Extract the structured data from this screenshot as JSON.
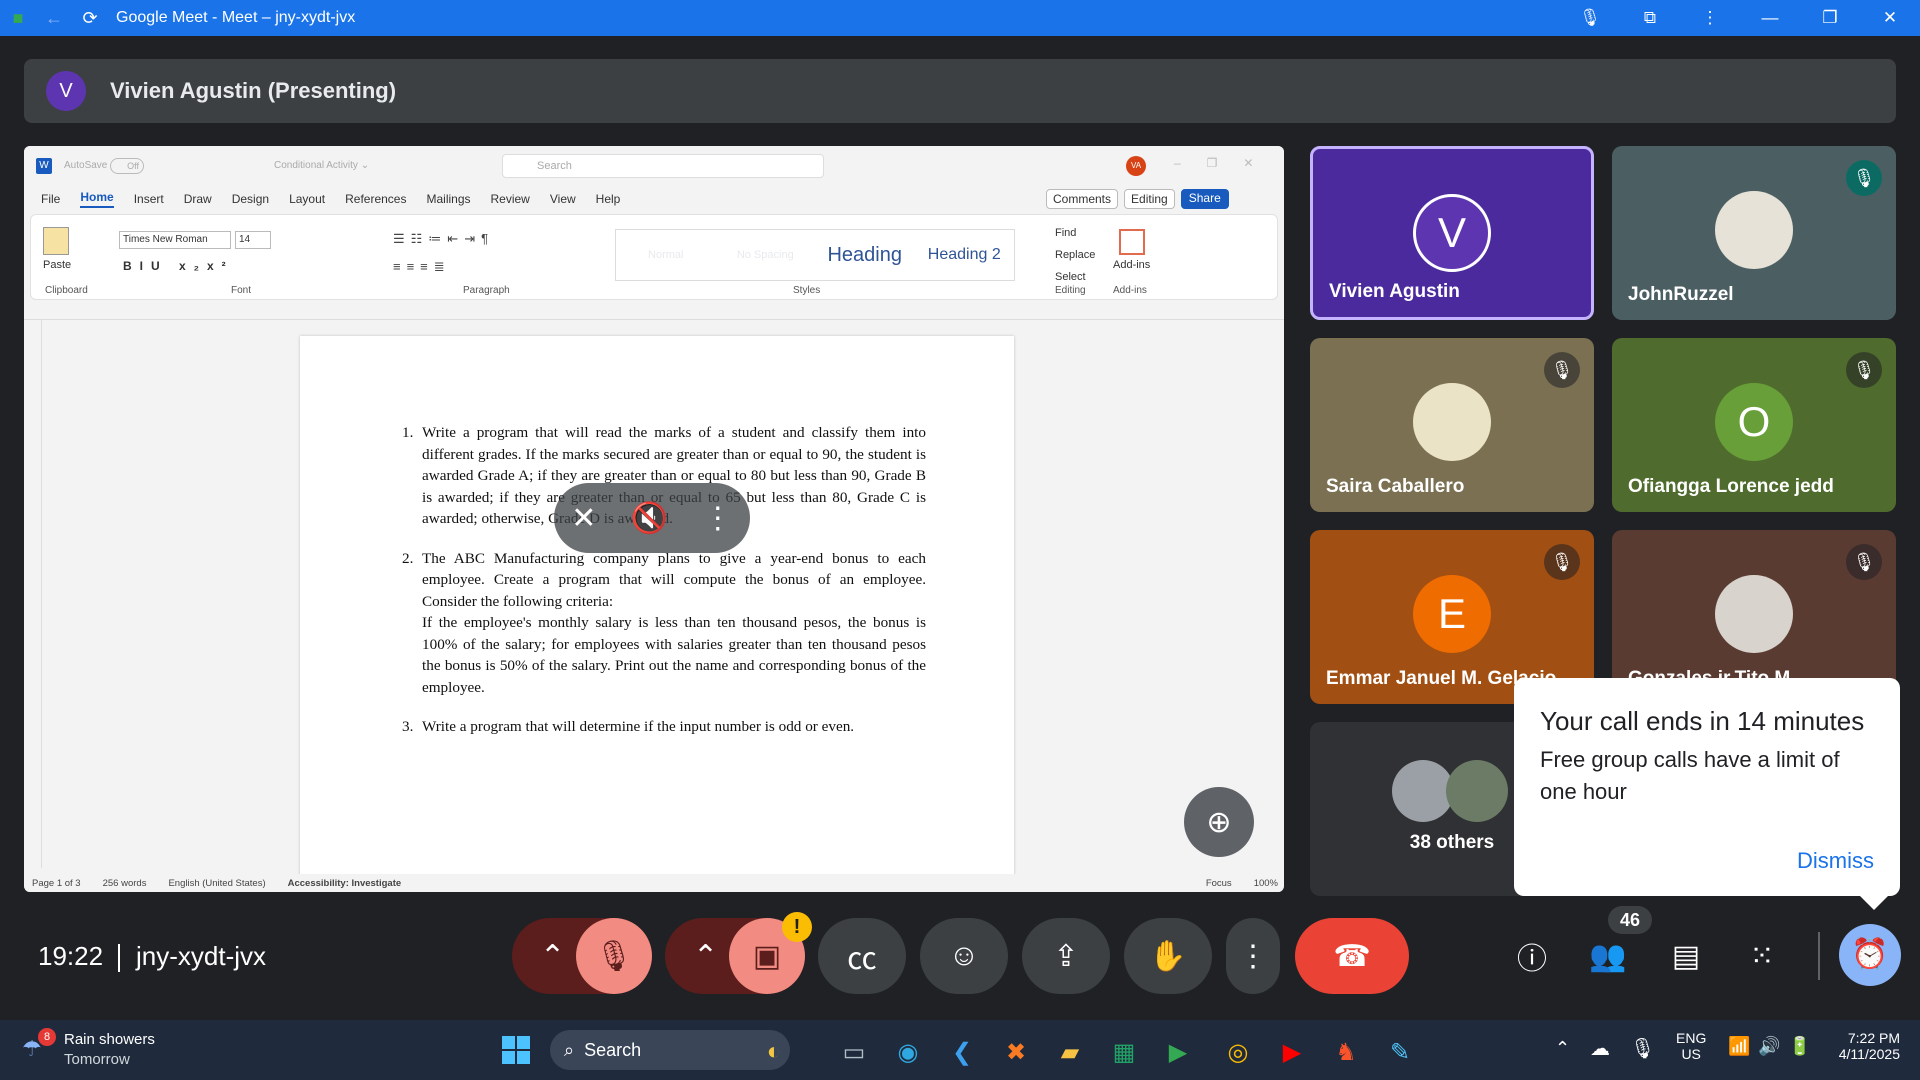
{
  "window": {
    "title": "Google Meet - Meet – jny-xydt-jvx",
    "back_icon": "back-arrow-icon",
    "reload_icon": "reload-icon"
  },
  "presenter_bar": {
    "avatar_letter": "V",
    "label": "Vivien Agustin (Presenting)"
  },
  "word": {
    "autosave": "AutoSave",
    "autosave_state": "Off",
    "doc_title": "Conditional Activity ⌄",
    "search_placeholder": "Search",
    "user_initials": "VA",
    "menu": [
      "File",
      "Home",
      "Insert",
      "Draw",
      "Design",
      "Layout",
      "References",
      "Mailings",
      "Review",
      "View",
      "Help"
    ],
    "comments": "Comments",
    "editing": "Editing",
    "share": "Share",
    "font_name": "Times New Roman",
    "font_size": "14",
    "paste": "Paste",
    "groups": [
      "Clipboard",
      "Font",
      "Paragraph",
      "Styles",
      "Editing",
      "Add-ins"
    ],
    "styles": [
      "Normal",
      "No Spacing",
      "Heading",
      "Heading 2"
    ],
    "editing_items": [
      "Find",
      "Replace",
      "Select"
    ],
    "addins": "Add-ins",
    "document": {
      "items": [
        {
          "num": "1.",
          "text": "Write a program that will read the marks of a student and classify them into different grades. If the marks secured are greater than or equal to 90, the student is awarded Grade A; if they are greater than or equal to 80 but less than 90, Grade B is awarded; if they are greater than or equal to 65 but less than 80, Grade C is awarded; otherwise, Grade D is awarded."
        },
        {
          "num": "2.",
          "text": "The ABC Manufacturing company plans to give a year-end bonus to each employee. Create a program that will compute the bonus of an employee. Consider the following criteria:",
          "text2": "If the employee's monthly salary is less than ten thousand pesos, the bonus is 100% of the salary; for employees with salaries greater than ten thousand pesos the bonus is 50% of the salary. Print out the name and corresponding bonus of the employee."
        },
        {
          "num": "3.",
          "text": "Write a program that will determine if the input number is odd or even."
        }
      ]
    },
    "status": {
      "page": "Page 1 of 3",
      "words": "256 words",
      "language": "English (United States)",
      "accessibility": "Accessibility: Investigate",
      "focus": "Focus",
      "zoom": "100%"
    }
  },
  "participants": [
    {
      "name": "Vivien Agustin",
      "letter": "V",
      "bg": "#4a2a9c",
      "av_bg": "#5e35b1",
      "muted": false,
      "active": true
    },
    {
      "name": "JohnRuzzel",
      "letter": "",
      "bg": "#4b5f63",
      "av_bg": "#e6e2d8",
      "muted": true
    },
    {
      "name": "Saira Caballero",
      "letter": "",
      "bg": "#7b7052",
      "av_bg": "#ebe3c5",
      "muted": true
    },
    {
      "name": "Ofiangga Lorence jedd",
      "letter": "O",
      "bg": "#4f6b2d",
      "av_bg": "#689f38",
      "muted": true
    },
    {
      "name": "Emmar Januel M. Gelacio",
      "letter": "E",
      "bg": "#a14f12",
      "av_bg": "#ef6c00",
      "muted": true
    },
    {
      "name": "Gonzales jr.Tito M.",
      "letter": "",
      "bg": "#5a3b32",
      "av_bg": "#d8d3cc",
      "muted": true
    }
  ],
  "others": {
    "label": "38 others"
  },
  "notice": {
    "title": "Your call ends in 14 minutes",
    "body": "Free group calls have a limit of one hour",
    "dismiss": "Dismiss"
  },
  "meeting": {
    "time": "19:22",
    "code": "jny-xydt-jvx",
    "people_count": "46",
    "camera_warning": "!"
  },
  "taskbar": {
    "weather_badge": "8",
    "weather_line1": "Rain showers",
    "weather_line2": "Tomorrow",
    "search": "Search",
    "lang1": "ENG",
    "lang2": "US",
    "clock_time": "7:22 PM",
    "clock_date": "4/11/2025"
  },
  "colors": {
    "meet_blue": "#1a73e8",
    "end_call_red": "#ea4335",
    "mic_off_bg": "#f28b82",
    "dark_red": "#5c1d1d"
  }
}
